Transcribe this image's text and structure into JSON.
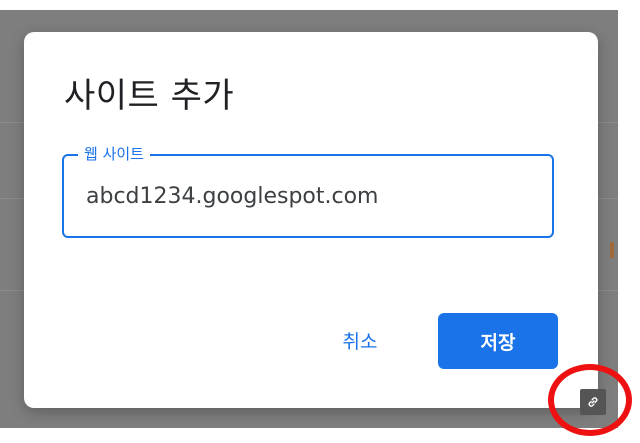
{
  "dialog": {
    "title": "사이트 추가",
    "field": {
      "label": "웹 사이트",
      "value": "abcd1234.googlespot.com"
    },
    "cancel_label": "취소",
    "save_label": "저장"
  },
  "icons": {
    "link": "link-icon"
  },
  "colors": {
    "accent": "#1a73e8",
    "backdrop": "#7e7e7e",
    "annotation": "#ee1111"
  }
}
